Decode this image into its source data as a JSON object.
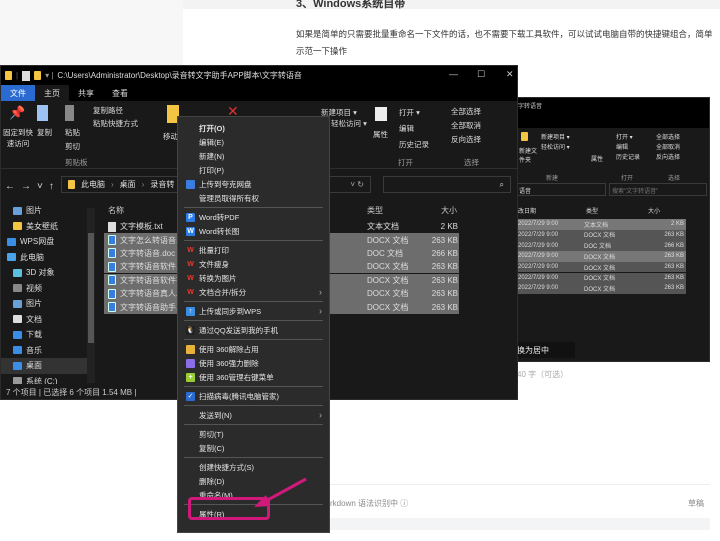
{
  "article": {
    "heading": "3、Windows系统自带",
    "paragraph": "如果是简单的只需要批量重命名一下文件的话，也不需要下载工具软件，可以试试电脑自带的快捷键组合，简单示范一下操作",
    "word_count": "40 字（可选）",
    "center_tip": "换为居中",
    "markdown_status": "rkdown 语法识别中 ⓘ",
    "draft": "草稿"
  },
  "explorer": {
    "title": "C:\\Users\\Administrator\\Desktop\\录音转文字助手APP脚本\\文字转语音",
    "tabs": [
      "文件",
      "主页",
      "共享",
      "查看"
    ],
    "ribbon": {
      "pin": "固定到快速访问",
      "copy": "复制",
      "paste": "粘贴",
      "copy_path": "复制路径",
      "paste_shortcut": "粘贴快捷方式",
      "cut": "剪切",
      "clipboard": "剪贴板",
      "move": "移动",
      "new_item": "新建项目 ▾",
      "easy_access": "轻松访问 ▾",
      "properties": "属性",
      "open": "打开 ▾",
      "edit": "编辑",
      "history": "历史记录",
      "open_group": "打开",
      "select_all": "全部选择",
      "select_none": "全部取消",
      "invert": "反向选择",
      "select_group": "选择"
    },
    "breadcrumb": [
      "此电脑",
      "桌面",
      "录音转"
    ],
    "sidebar": [
      {
        "label": "图片",
        "icon": "picture"
      },
      {
        "label": "美女壁纸",
        "icon": "folder"
      },
      {
        "label": "WPS网盘",
        "icon": "cloud"
      },
      {
        "label": "此电脑",
        "icon": "pc"
      },
      {
        "label": "3D 对象",
        "icon": "cube"
      },
      {
        "label": "视频",
        "icon": "video"
      },
      {
        "label": "图片",
        "icon": "picture"
      },
      {
        "label": "文档",
        "icon": "document"
      },
      {
        "label": "下载",
        "icon": "download"
      },
      {
        "label": "音乐",
        "icon": "music"
      },
      {
        "label": "桌面",
        "icon": "desktop"
      },
      {
        "label": "系统 (C:)",
        "icon": "drive"
      }
    ],
    "columns": {
      "name": "名称",
      "type": "类型",
      "size": "大小"
    },
    "files": [
      {
        "name": "文字模板.txt",
        "type": "文本文档",
        "size": "2 KB",
        "selected": false,
        "icon": "txt"
      },
      {
        "name": "文字怎么转语音.docx",
        "type": "DOCX 文档",
        "size": "263 KB",
        "selected": true,
        "icon": "doc"
      },
      {
        "name": "文字转语音.doc",
        "type": "DOC 文档",
        "size": "266 KB",
        "selected": true,
        "icon": "doc"
      },
      {
        "name": "文字转语音软件.docx",
        "type": "DOCX 文档",
        "size": "263 KB",
        "selected": true,
        "icon": "doc"
      },
      {
        "name": "文字转语音软件有哪些.docx",
        "type": "DOCX 文档",
        "size": "263 KB",
        "selected": true,
        "icon": "doc"
      },
      {
        "name": "文字转语音真人发声.docx",
        "type": "DOCX 文档",
        "size": "263 KB",
        "selected": true,
        "icon": "doc"
      },
      {
        "name": "文字转语音助手.docx",
        "type": "DOCX 文档",
        "size": "263 KB",
        "selected": true,
        "icon": "doc"
      }
    ],
    "status": "7 个项目  |  已选择 6 个项目  1.54 MB  |"
  },
  "explorer2": {
    "title": "字转语音",
    "group_new": "新建",
    "new_folder": "新建文件夹",
    "new_item": "新建项目 ▾",
    "easy_access": "轻松访问 ▾",
    "properties": "属性",
    "open": "打开 ▾",
    "edit": "编辑",
    "history": "历史记录",
    "open_group": "打开",
    "select_all": "全部选择",
    "select_none": "全部取消",
    "invert": "反向选择",
    "select_group": "选择",
    "address": "语音",
    "search_placeholder": "搜索\"文字转语音\"",
    "columns": {
      "date": "改日期",
      "type": "类型",
      "size": "大小"
    },
    "rows": [
      {
        "date": "2022/7/29 9:00",
        "type": "文本文档",
        "size": "2 KB"
      },
      {
        "date": "2022/7/29 9:00",
        "type": "DOCX 文档",
        "size": "263 KB"
      },
      {
        "date": "2022/7/29 9:00",
        "type": "DOC 文档",
        "size": "266 KB"
      },
      {
        "date": "2022/7/29 9:00",
        "type": "DOCX 文档",
        "size": "263 KB"
      },
      {
        "date": "2022/7/29 9:00",
        "type": "DOCX 文档",
        "size": "263 KB"
      },
      {
        "date": "2022/7/29 9:00",
        "type": "DOCX 文档",
        "size": "263 KB"
      },
      {
        "date": "2022/7/29 9:00",
        "type": "DOCX 文档",
        "size": "263 KB"
      }
    ]
  },
  "context_menu": [
    {
      "label": "打开(O)",
      "bold": true
    },
    {
      "label": "编辑(E)"
    },
    {
      "label": "新建(N)"
    },
    {
      "label": "打印(P)"
    },
    {
      "label": "上传到夸克网盘",
      "icon": "quark"
    },
    {
      "label": "管理员取得所有权",
      "sep": true
    },
    {
      "label": "Word转PDF",
      "icon": "word-pdf"
    },
    {
      "label": "Word转长图",
      "icon": "word-image",
      "sep": true
    },
    {
      "label": "批量打印",
      "icon": "wps"
    },
    {
      "label": "文件瘦身",
      "icon": "wps"
    },
    {
      "label": "转换为图片",
      "icon": "wps"
    },
    {
      "label": "文档合并/拆分",
      "icon": "wps",
      "submenu": true,
      "sep": true
    },
    {
      "label": "上传或同步到WPS",
      "icon": "wps-cloud",
      "submenu": true,
      "sep": true
    },
    {
      "label": "通过QQ发送到我的手机",
      "icon": "qq",
      "sep": true
    },
    {
      "label": "使用 360解除占用",
      "icon": "360-unlock"
    },
    {
      "label": "使用 360强力删除",
      "icon": "360-delete"
    },
    {
      "label": "使用 360管理右键菜单",
      "icon": "360-manage",
      "sep": true
    },
    {
      "label": "扫描病毒(腾讯电脑管家)",
      "icon": "shield",
      "sep": true
    },
    {
      "label": "发送到(N)",
      "submenu": true,
      "sep": true
    },
    {
      "label": "剪切(T)"
    },
    {
      "label": "复制(C)",
      "sep": true
    },
    {
      "label": "创建快捷方式(S)"
    },
    {
      "label": "删除(D)"
    },
    {
      "label": "重命名(M)",
      "highlighted": true,
      "sep": true
    },
    {
      "label": "属性(R)"
    }
  ],
  "colors": {
    "highlight": "#d0197a",
    "accent": "#2b6bd1"
  }
}
